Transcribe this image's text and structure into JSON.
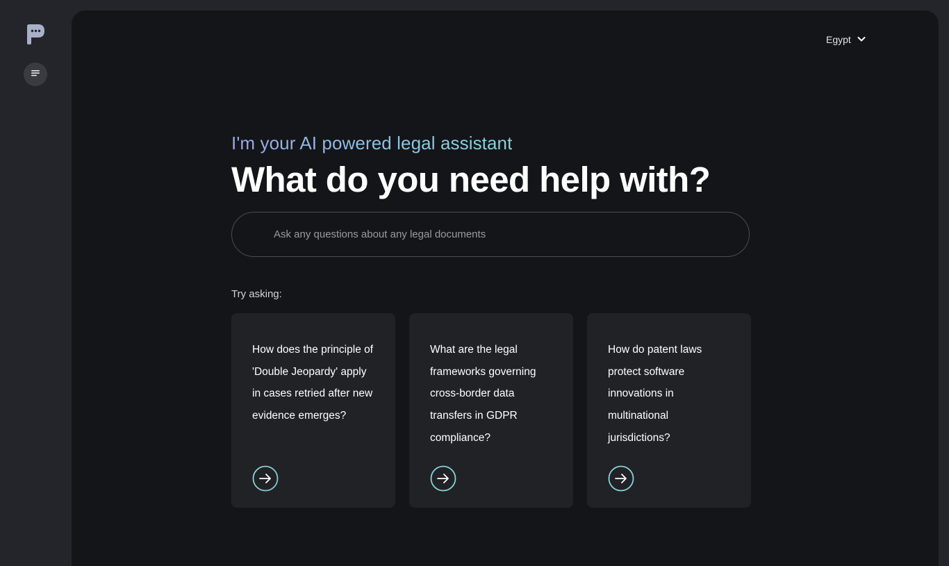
{
  "header": {
    "country": "Egypt"
  },
  "hero": {
    "subtitle": "I'm your AI powered legal assistant",
    "title": "What do you need help with?"
  },
  "search": {
    "placeholder": "Ask any questions about any legal documents",
    "value": ""
  },
  "suggestions": {
    "label": "Try asking:",
    "items": [
      {
        "text": "How does the principle of 'Double Jeopardy' apply in cases retried after new evidence emerges?"
      },
      {
        "text": "What are the legal frameworks governing cross-border data transfers in GDPR compliance?"
      },
      {
        "text": "How do patent laws protect software innovations in multinational jurisdictions?"
      }
    ]
  },
  "icons": {
    "logo": "chat-bubble-logo-icon",
    "menu": "menu-lines-icon",
    "country_dropdown": "chevron-down-icon",
    "suggestion_arrow": "arrow-right-circle-icon"
  },
  "colors": {
    "page_background": "#24252a",
    "panel_background": "#141518",
    "card_background": "#212226",
    "accent_teal": "#86d6db",
    "accent_blue": "#9aa8ea"
  }
}
